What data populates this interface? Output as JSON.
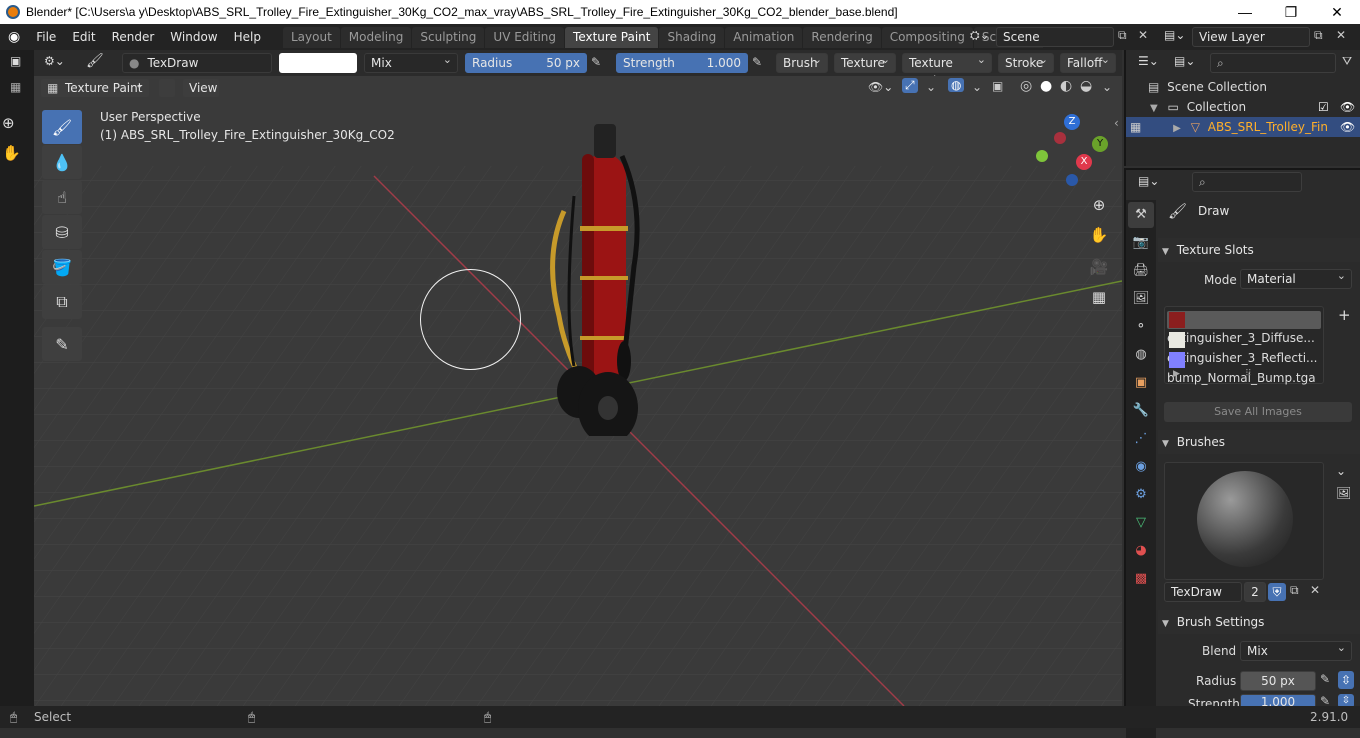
{
  "window": {
    "title": "Blender* [C:\\Users\\a y\\Desktop\\ABS_SRL_Trolley_Fire_Extinguisher_30Kg_CO2_max_vray\\ABS_SRL_Trolley_Fire_Extinguisher_30Kg_CO2_blender_base.blend]"
  },
  "menu": [
    "File",
    "Edit",
    "Render",
    "Window",
    "Help"
  ],
  "workspaces": [
    "Layout",
    "Modeling",
    "Sculpting",
    "UV Editing",
    "Texture Paint",
    "Shading",
    "Animation",
    "Rendering",
    "Compositing",
    "Scripting"
  ],
  "workspace_active": "Texture Paint",
  "scene": "Scene",
  "view_layer": "View Layer",
  "toolheader": {
    "brush_name": "TexDraw",
    "blend": "Mix",
    "radius_label": "Radius",
    "radius_value": "50 px",
    "strength_label": "Strength",
    "strength_value": "1.000",
    "brush": "Brush",
    "texture": "Texture",
    "texture_mask": "Texture Mask",
    "stroke": "Stroke",
    "falloff": "Falloff"
  },
  "viewport_header": {
    "mode": "Texture Paint",
    "view": "View"
  },
  "viewport": {
    "perspective": "User Perspective",
    "object": "(1) ABS_SRL_Trolley_Fire_Extinguisher_30Kg_CO2",
    "gizmo": {
      "z": "Z",
      "y": "Y",
      "x": "X"
    }
  },
  "outliner": {
    "scene_collection": "Scene Collection",
    "collection": "Collection",
    "object": "ABS_SRL_Trolley_Fin"
  },
  "properties": {
    "tool": "Draw",
    "texture_slots": {
      "title": "Texture Slots",
      "mode_label": "Mode",
      "mode_value": "Material",
      "slots": [
        "extinguisher_3_Diffuse...",
        "extinguisher_3_Reflecti...",
        "bump_Normal_Bump.tga"
      ],
      "save_all": "Save All Images"
    },
    "brushes": {
      "title": "Brushes",
      "name": "TexDraw",
      "users": "2"
    },
    "brush_settings": {
      "title": "Brush Settings",
      "blend_label": "Blend",
      "blend_value": "Mix",
      "radius_label": "Radius",
      "radius_value": "50 px",
      "strength_label": "Strength",
      "strength_value": "1.000"
    }
  },
  "status": {
    "select": "Select",
    "version": "2.91.0"
  }
}
